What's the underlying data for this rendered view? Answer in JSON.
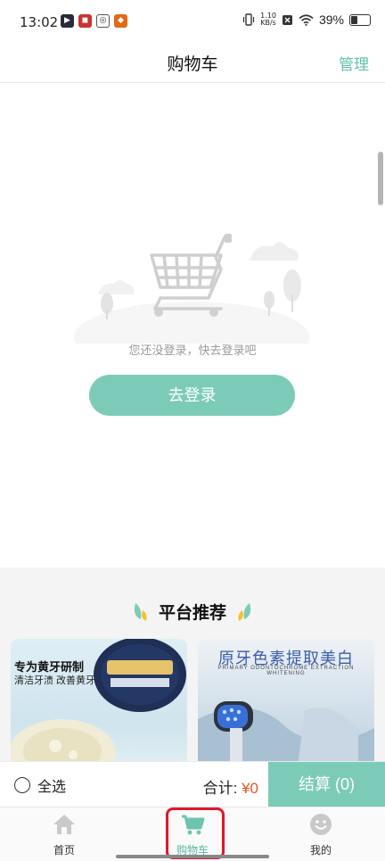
{
  "status_bar": {
    "time": "13:02",
    "net_speed_value": "1.10",
    "net_speed_unit": "KB/s",
    "battery": "39%"
  },
  "header": {
    "title": "购物车",
    "manage_label": "管理"
  },
  "empty_state": {
    "message": "您还没登录，快去登录吧",
    "login_button": "去登录"
  },
  "recommend": {
    "title": "平台推荐",
    "products": [
      {
        "line1": "专为黄牙研制",
        "line2": "清洁牙渍 改善黄牙"
      },
      {
        "line1": "原牙色素提取美白",
        "line2": "PRIMARY ODONTOCHROME EXTRACTION WHITENING"
      }
    ]
  },
  "checkout": {
    "select_all": "全选",
    "total_label": "合计:",
    "total_amount": "¥0",
    "checkout_button": "结算 (0)"
  },
  "bottom_nav": {
    "items": [
      {
        "label": "首页",
        "icon": "home-icon"
      },
      {
        "label": "购物车",
        "icon": "cart-icon",
        "active": true
      },
      {
        "label": "我的",
        "icon": "smiley-icon"
      }
    ]
  },
  "colors": {
    "accent": "#7ccbb9",
    "price": "#e2541f",
    "highlight": "#e0182a"
  }
}
